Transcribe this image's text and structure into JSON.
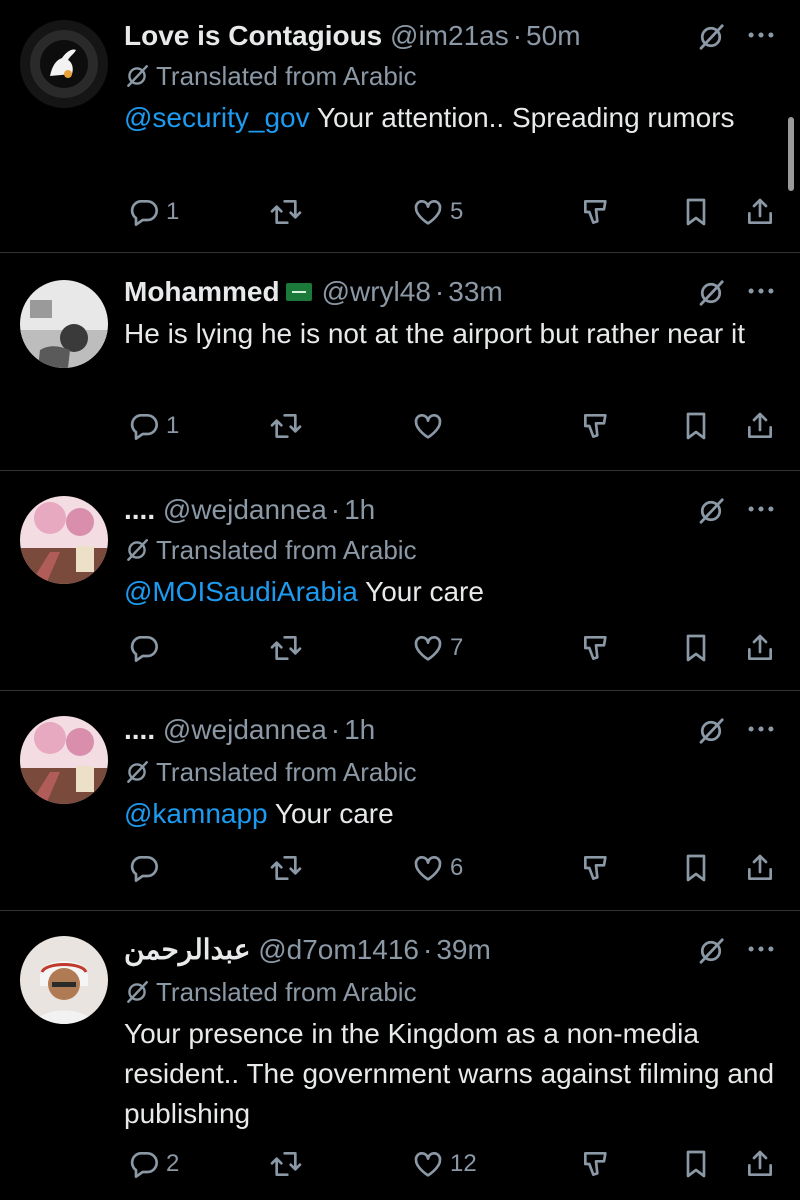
{
  "translated_label": "Translated from Arabic",
  "tweets": [
    {
      "name": "Love is Contagious",
      "handle": "@im21as",
      "time": "50m",
      "mention": "@security_gov",
      "text": " Your attention.. Spreading rumors",
      "replies": "1",
      "likes": "5"
    },
    {
      "name": "Mohammed",
      "handle": "@wryl48",
      "time": "33m",
      "text": "He is lying he is not at the airport but rather near it",
      "replies": "1",
      "likes": ""
    },
    {
      "name": "....",
      "handle": "@wejdannea",
      "time": "1h",
      "mention": "@MOISaudiArabia",
      "text": " Your care",
      "replies": "",
      "likes": "7"
    },
    {
      "name": "....",
      "handle": "@wejdannea",
      "time": "1h",
      "mention": "@kamnapp",
      "text": " Your care",
      "replies": "",
      "likes": "6"
    },
    {
      "name": "عبدالرحمن",
      "handle": "@d7om1416",
      "time": "39m",
      "text": "Your presence in the Kingdom as a non-media resident.. The government warns against filming and publishing",
      "replies": "2",
      "likes": "12"
    }
  ],
  "colors": {
    "background": "#000000",
    "text": "#e7e9ea",
    "muted": "#8b98a5",
    "mention": "#1d9bf0",
    "divider": "#2f3336"
  },
  "icons": [
    "reply-icon",
    "retweet-icon",
    "like-icon",
    "views-icon",
    "bookmark-icon",
    "share-icon",
    "translate-icon",
    "more-icon"
  ]
}
